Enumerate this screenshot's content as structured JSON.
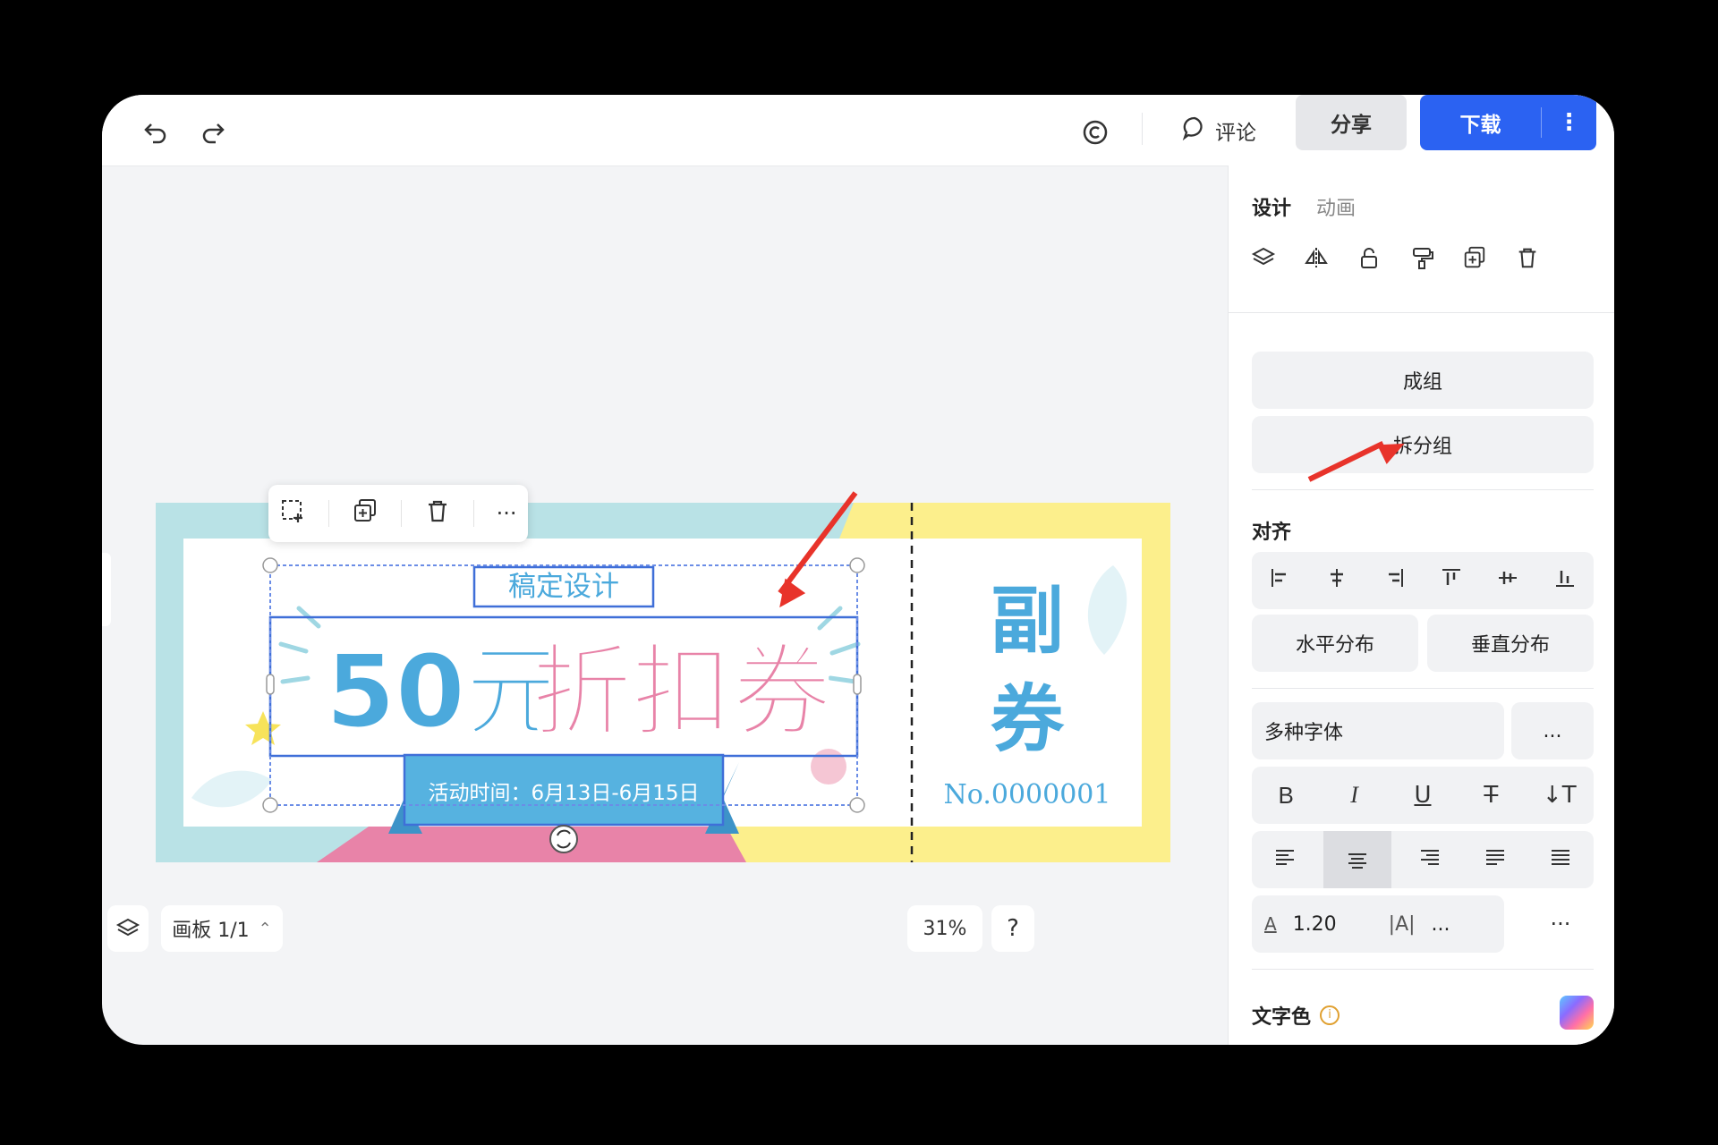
{
  "topbar": {
    "undo_icon": "undo-icon",
    "redo_icon": "redo-icon",
    "copyright_icon": "copyright-icon",
    "comment_label": "评论",
    "share_label": "分享",
    "download_label": "下载",
    "more_glyph": "⋮"
  },
  "panel": {
    "tabs": [
      {
        "label": "设计",
        "active": true
      },
      {
        "label": "动画",
        "active": false
      }
    ],
    "tool_icons": [
      "layers-icon",
      "flip-icon",
      "lock-icon",
      "format-painter-icon",
      "duplicate-icon",
      "trash-icon"
    ],
    "group_label": "成组",
    "ungroup_label": "拆分组",
    "align_title": "对齐",
    "align_icons": [
      "align-left-icon",
      "align-center-h-icon",
      "align-right-icon",
      "align-top-icon",
      "align-middle-icon",
      "align-bottom-icon"
    ],
    "h_distribute_label": "水平分布",
    "v_distribute_label": "垂直分布",
    "font_value": "多种字体",
    "font_size_value": "...",
    "style_buttons": [
      "B",
      "I",
      "U",
      "T",
      "↓T"
    ],
    "text_align_icons": [
      "text-align-left-icon",
      "text-align-center-icon",
      "text-align-right-icon",
      "text-justify-icon",
      "text-distribute-icon"
    ],
    "line_height_value": "1.20",
    "letter_spacing_value": "...",
    "more_dots": "···",
    "text_color_label": "文字色"
  },
  "canvas": {
    "ticket": {
      "brand_text": "稿定设计",
      "headline_part1": "50元",
      "headline_part2": "折扣券",
      "date_text": "活动时间：6月13日-6月15日",
      "stub_text_1": "副",
      "stub_text_2": "券",
      "serial_text": "No.0000001"
    },
    "float_toolbar_icons": [
      "select-add-icon",
      "duplicate-icon",
      "trash-icon",
      "more-icon"
    ],
    "more_glyph": "···"
  },
  "bottom": {
    "board_label": "画板 1/1",
    "zoom_label": "31%",
    "help_label": "?"
  },
  "colors": {
    "accent": "#2b62f2",
    "teal": "#b9e2e6",
    "yellow": "#fcef8c",
    "pink": "#e883a8",
    "blue_text": "#4ba9dc"
  }
}
